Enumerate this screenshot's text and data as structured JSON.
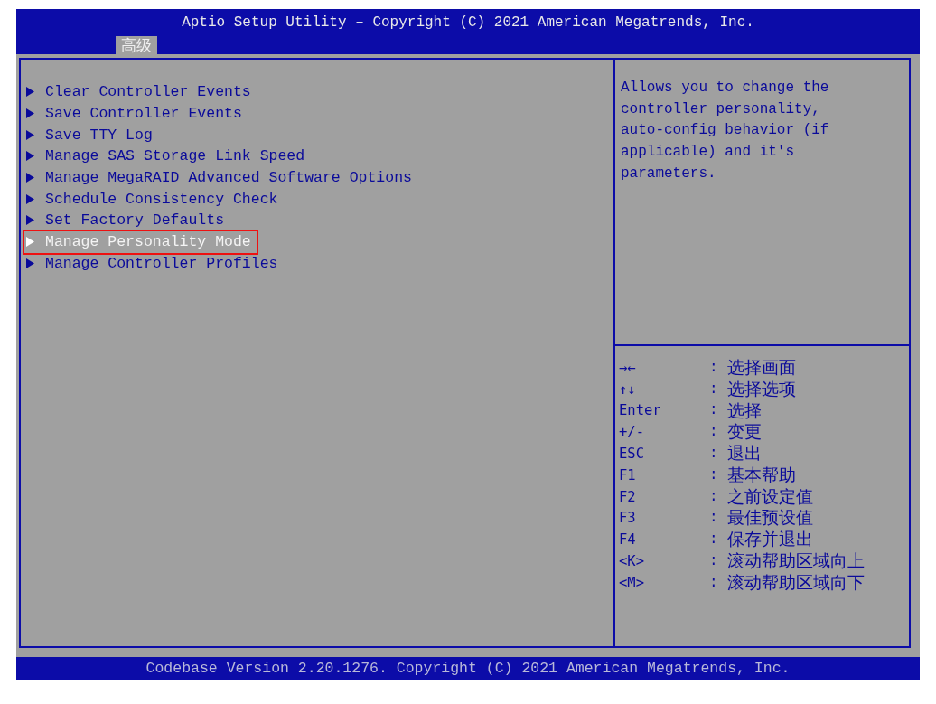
{
  "header": {
    "title": "Aptio Setup Utility – Copyright (C) 2021 American Megatrends, Inc.",
    "tabs": [
      {
        "label": "高级",
        "selected": true
      }
    ]
  },
  "menu": {
    "items": [
      {
        "label": "Clear Controller Events",
        "selected": false
      },
      {
        "label": "Save Controller Events",
        "selected": false
      },
      {
        "label": "Save TTY Log",
        "selected": false
      },
      {
        "label": "Manage SAS Storage Link Speed",
        "selected": false
      },
      {
        "label": "Manage MegaRAID Advanced Software Options",
        "selected": false
      },
      {
        "label": "Schedule Consistency Check",
        "selected": false
      },
      {
        "label": "Set Factory Defaults",
        "selected": false
      },
      {
        "label": "Manage Personality Mode",
        "selected": true
      },
      {
        "label": "Manage Controller Profiles",
        "selected": false
      }
    ]
  },
  "help": {
    "text": "Allows you to change the controller personality, auto-config behavior (if applicable) and it's parameters."
  },
  "keys": [
    {
      "key": "→←",
      "sep": ":",
      "action": "选择画面"
    },
    {
      "key": "↑↓",
      "sep": ":",
      "action": "选择选项"
    },
    {
      "key": "Enter",
      "sep": ":",
      "action": "选择"
    },
    {
      "key": "+/-",
      "sep": ":",
      "action": "变更"
    },
    {
      "key": "ESC",
      "sep": ":",
      "action": "退出"
    },
    {
      "key": "F1",
      "sep": ":",
      "action": "基本帮助"
    },
    {
      "key": "F2",
      "sep": ":",
      "action": "之前设定值"
    },
    {
      "key": "F3",
      "sep": ":",
      "action": "最佳预设值"
    },
    {
      "key": "F4",
      "sep": ":",
      "action": "保存并退出"
    },
    {
      "key": "<K>",
      "sep": ":",
      "action": "滚动帮助区域向上"
    },
    {
      "key": "<M>",
      "sep": ":",
      "action": "滚动帮助区域向下"
    }
  ],
  "footer": {
    "text": "Codebase Version 2.20.1276. Copyright (C) 2021 American Megatrends, Inc."
  }
}
